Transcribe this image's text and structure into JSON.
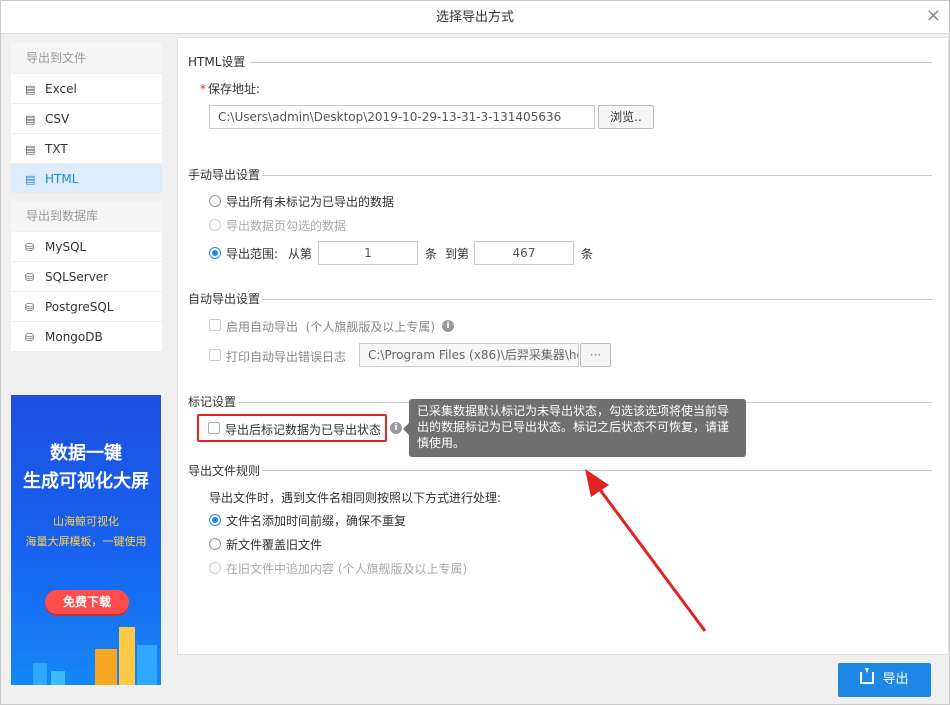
{
  "window": {
    "title": "选择导出方式",
    "close_glyph": "×"
  },
  "sidebar": {
    "file_group_title": "导出到文件",
    "file_items": [
      {
        "label": "Excel",
        "icon": "file-icon"
      },
      {
        "label": "CSV",
        "icon": "file-icon"
      },
      {
        "label": "TXT",
        "icon": "file-icon"
      },
      {
        "label": "HTML",
        "icon": "file-icon",
        "active": true
      }
    ],
    "db_group_title": "导出到数据库",
    "db_items": [
      {
        "label": "MySQL",
        "icon": "database-icon"
      },
      {
        "label": "SQLServer",
        "icon": "database-icon"
      },
      {
        "label": "PostgreSQL",
        "icon": "database-icon"
      },
      {
        "label": "MongoDB",
        "icon": "database-icon"
      }
    ]
  },
  "banner": {
    "line1": "数据一键",
    "line2": "生成可视化大屏",
    "sub1": "山海鲸可视化",
    "sub2": "海量大屏模板，一键使用",
    "button": "免费下载"
  },
  "html_settings": {
    "title": "HTML设置",
    "save_label": "保存地址:",
    "required_mark": "*",
    "save_path": "C:\\Users\\admin\\Desktop\\2019-10-29-13-31-3-131405636",
    "browse_label": "浏览.."
  },
  "manual": {
    "title": "手动导出设置",
    "opt_all": "导出所有未标记为已导出的数据",
    "opt_checked": "导出数据页勾选的数据",
    "opt_range": "导出范围:",
    "from_label": "从第",
    "from_value": "1",
    "unit1": "条",
    "to_label": "到第",
    "to_value": "467",
    "unit2": "条"
  },
  "auto": {
    "title": "自动导出设置",
    "enable_label": "启用自动导出",
    "enable_note": "(个人旗舰版及以上专属)",
    "log_label": "打印自动导出错误日志",
    "log_path": "C:\\Program Files (x86)\\后羿采集器\\ho",
    "log_browse": "···"
  },
  "mark": {
    "title": "标记设置",
    "checkbox_label": "导出后标记数据为已导出状态",
    "tooltip": "已采集数据默认标记为未导出状态，勾选该选项将使当前导出的数据标记为已导出状态。标记之后状态不可恢复，请谨慎使用。"
  },
  "rule": {
    "title": "导出文件规则",
    "desc": "导出文件时，遇到文件名相同则按照以下方式进行处理:",
    "opt1": "文件名添加时间前缀，确保不重复",
    "opt2": "新文件覆盖旧文件",
    "opt3": "在旧文件中追加内容 (个人旗舰版及以上专属)"
  },
  "footer": {
    "export_label": "导出"
  },
  "colors": {
    "accent": "#1e88e5",
    "highlight": "#e52222",
    "banner_bg": "#1763f0"
  }
}
